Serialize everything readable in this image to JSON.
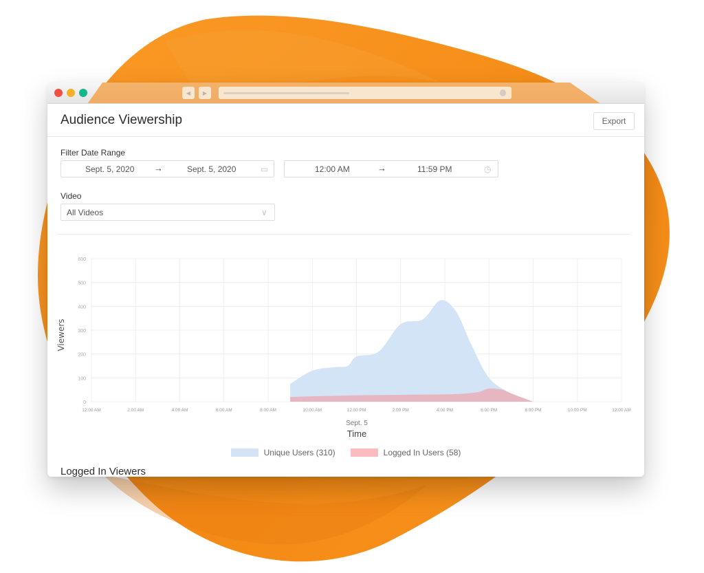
{
  "colors": {
    "blob_orange": "#f8931f",
    "blob_dark": "#f07e12",
    "traffic_red": "#f25042",
    "traffic_yellow": "#f7b02b",
    "traffic_green": "#12b886",
    "unique_fill": "#d3e4f6",
    "logged_fill": "#e9b1bb",
    "logged_swatch": "#fbbcbf",
    "grid": "#efefef"
  },
  "browser": {
    "back_icon": "◀",
    "forward_icon": "▶"
  },
  "header": {
    "title": "Audience Viewership",
    "export_label": "Export"
  },
  "filters": {
    "date_range_label": "Filter Date Range",
    "start_date": "Sept. 5, 2020",
    "end_date": "Sept. 5, 2020",
    "start_time": "12:00 AM",
    "end_time": "11:59 PM",
    "arrow": "→",
    "calendar_icon": "▭",
    "clock_icon": "◷",
    "video_label": "Video",
    "video_selected": "All Videos",
    "chevron_icon": "∨"
  },
  "chart_data": {
    "type": "area",
    "title": "",
    "xlabel": "Time",
    "xsublabel": "Sept. 5",
    "ylabel": "Viewers",
    "ylim": [
      0,
      600
    ],
    "yticks": [
      0,
      100,
      200,
      300,
      400,
      500,
      600
    ],
    "xlim_hours": [
      0,
      24
    ],
    "xticks": [
      "12:00 AM",
      "2:00 AM",
      "4:00 AM",
      "6:00 AM",
      "8:00 AM",
      "10:00 AM",
      "12:00 PM",
      "2:00 PM",
      "4:00 PM",
      "6:00 PM",
      "8:00 PM",
      "10:00 PM",
      "12:00 AM"
    ],
    "grid": true,
    "legend_position": "bottom",
    "series": [
      {
        "name": "Unique Users (310)",
        "x_hours": [
          9,
          10,
          11,
          11.6,
          12,
          13,
          14,
          15,
          15.8,
          16.5,
          17.2,
          18,
          19,
          20
        ],
        "values": [
          75,
          130,
          145,
          150,
          190,
          210,
          325,
          345,
          425,
          380,
          240,
          100,
          35,
          0
        ]
      },
      {
        "name": "Logged In Users (58)",
        "x_hours": [
          9,
          11,
          13,
          15,
          16.5,
          17.5,
          18,
          18.6,
          19,
          20
        ],
        "values": [
          20,
          25,
          28,
          30,
          32,
          40,
          55,
          50,
          35,
          0
        ]
      }
    ]
  },
  "legend": {
    "unique_label": "Unique Users (310)",
    "logged_label": "Logged In Users (58)"
  },
  "sections": {
    "logged_in_viewers": "Logged In Viewers"
  }
}
